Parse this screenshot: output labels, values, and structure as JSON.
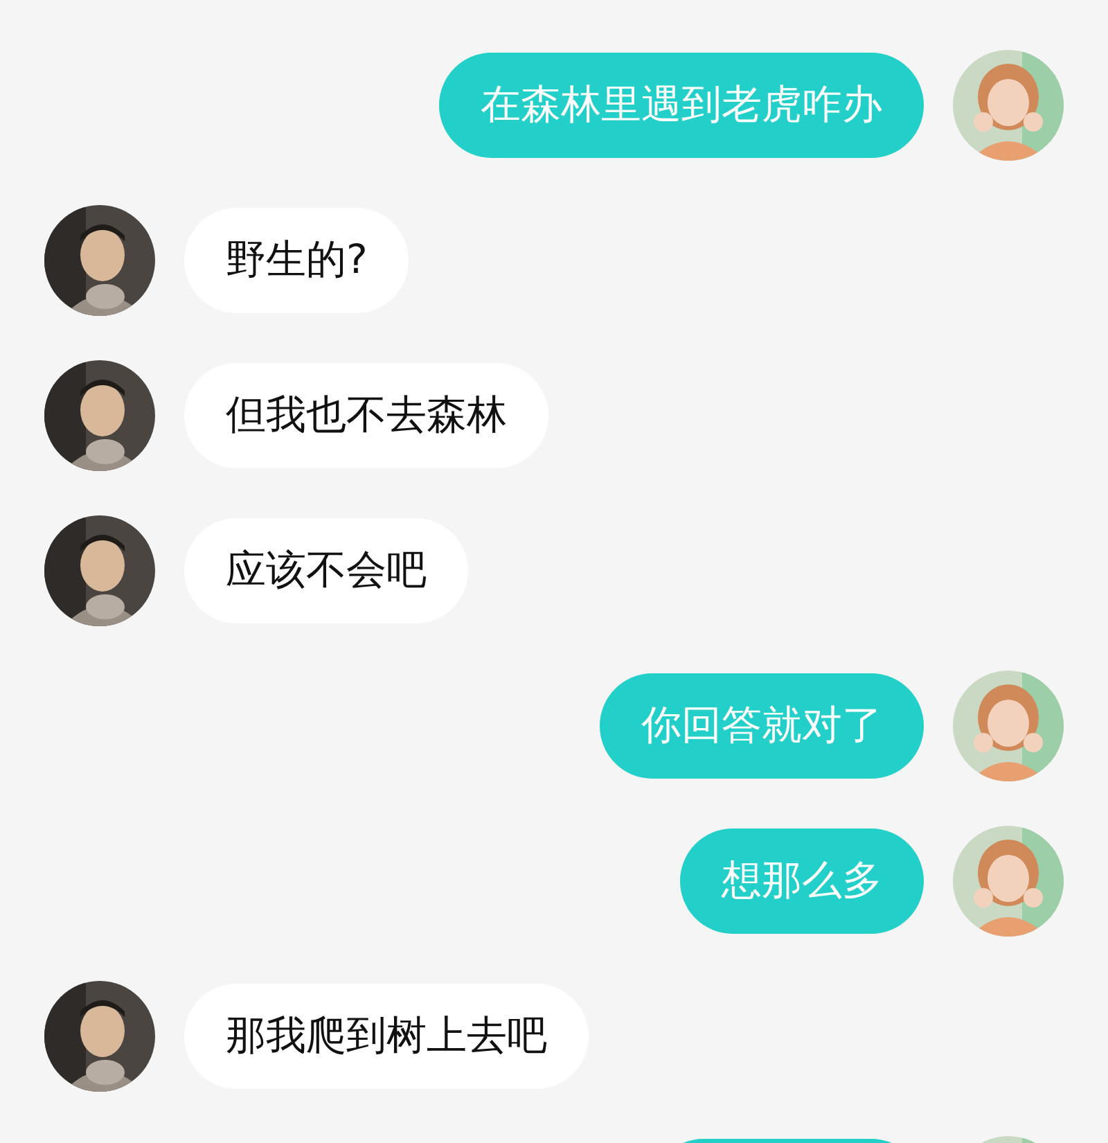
{
  "messages": [
    {
      "mine": true,
      "text": "在森林里遇到老虎咋办"
    },
    {
      "mine": false,
      "text": "野生的?"
    },
    {
      "mine": false,
      "text": "但我也不去森林"
    },
    {
      "mine": false,
      "text": "应该不会吧"
    },
    {
      "mine": true,
      "text": "你回答就对了"
    },
    {
      "mine": true,
      "text": "想那么多"
    },
    {
      "mine": false,
      "text": "那我爬到树上去吧"
    },
    {
      "mine": true
    }
  ]
}
